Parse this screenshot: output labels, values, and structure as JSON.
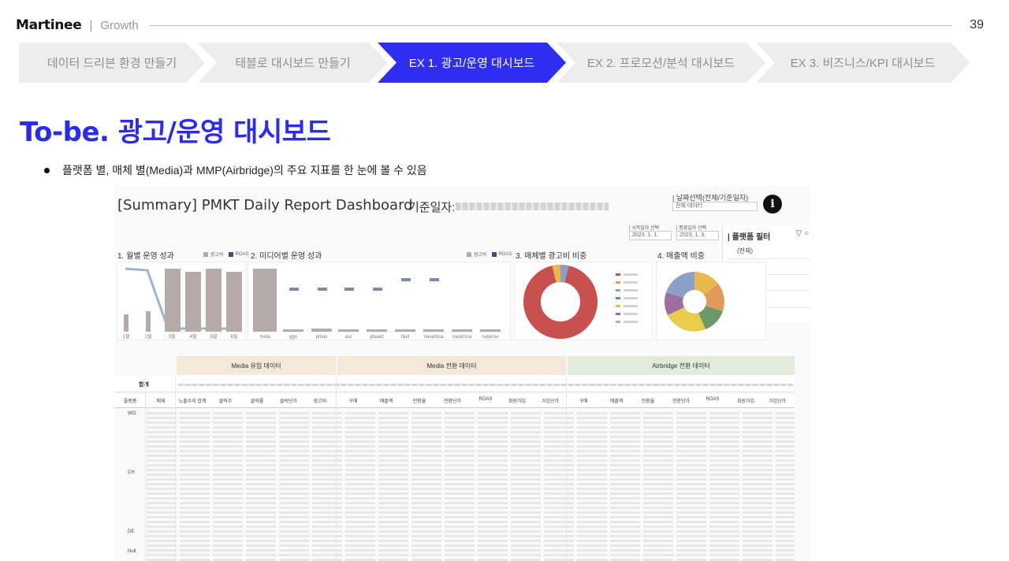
{
  "header": {
    "logo": "Martinee",
    "separator": "|",
    "section": "Growth",
    "page_number": "39"
  },
  "steps": [
    {
      "label": "데이터 드리븐 환경 만들기",
      "active": false
    },
    {
      "label": "태블로 대시보드 만들기",
      "active": false
    },
    {
      "label": "EX 1. 광고/운영 대시보드",
      "active": true
    },
    {
      "label": "EX 2. 프로모션/분석 대시보드",
      "active": false
    },
    {
      "label": "EX 3. 비즈니스/KPI 대시보드",
      "active": false
    }
  ],
  "title": "To-be. 광고/운영 대시보드",
  "bullet": "플랫폼 별, 매체 별(Media)과 MMP(Airbridge)의 주요 지표를 한 눈에 볼 수 있음",
  "colors": {
    "accent": "#2f2ef0",
    "step_inactive": "#ededed",
    "media_header": "#f3e8da",
    "airbridge_header": "#e3ecdc"
  },
  "dashboard": {
    "title": "[Summary] PMKT Daily Report Dashboard",
    "date_label": "기준일자:",
    "date_filter_label": "| 날짜선택(전체/기준일자)",
    "date_filter_value": "전체 데이터",
    "start_date_label": "| 시작일자 선택",
    "start_date_value": "2023. 1. 1.",
    "end_date_label": "| 종료일자 선택",
    "end_date_value": "2023. 1. 3.",
    "info_icon": "i",
    "platform_filter": {
      "title": "| 플랫폼 필터",
      "all_option": "(전체)"
    },
    "charts": [
      {
        "label": "1. 월별 운영 성과",
        "legend": [
          "광고비",
          "ROAS"
        ],
        "x_labels": [
          "1월",
          "2월",
          "3월",
          "4월",
          "5월",
          "6월"
        ]
      },
      {
        "label": "2. 미디어별 운영 성과",
        "legend": [
          "광고비",
          "ROAS"
        ],
        "x_labels": [
          "meta",
          "ggn",
          "pmax",
          "asc",
          "ybeact",
          "Null",
          "naverbsa",
          "naverssa",
          "naverse"
        ]
      },
      {
        "label": "3. 매체별 광고비 비중"
      },
      {
        "label": "4. 매출액 비중"
      }
    ],
    "table": {
      "groups": [
        "Media 유입 데이터",
        "Media 전환 데이터",
        "Airbridge 전환 데이터"
      ],
      "total_label": "합계",
      "columns": [
        "플랫폼",
        "매체",
        "노출수의 합계",
        "클릭수",
        "클릭률",
        "클릭단가",
        "광고비",
        "구매",
        "매출액",
        "전환율",
        "전환단가",
        "ROAS",
        "회원가입",
        "가입단가",
        "구매",
        "매출액",
        "전환율",
        "전환단가",
        "ROAS",
        "회원가입",
        "가입단가"
      ],
      "row_groups": [
        "WO",
        "CH",
        "DE",
        "Null"
      ]
    }
  }
}
